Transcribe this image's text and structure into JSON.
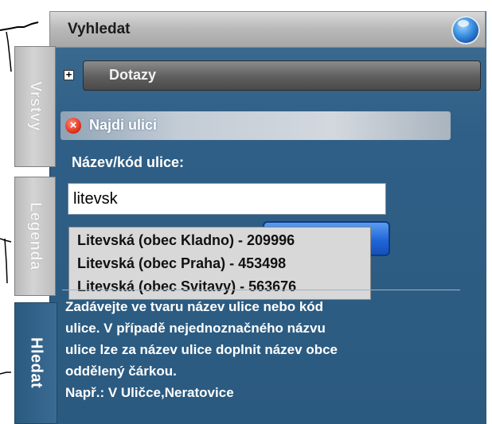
{
  "panel": {
    "title": "Vyhledat"
  },
  "tabs": [
    {
      "label": "Vrstvy"
    },
    {
      "label": "Legenda"
    },
    {
      "label": "Hledat"
    }
  ],
  "queries": {
    "expand_symbol": "+",
    "label": "Dotazy"
  },
  "find_street": {
    "close_symbol": "×",
    "title": "Najdi ulici",
    "field_label": "Název/kód ulice:",
    "input_value": "litevsk",
    "search_button_label": ""
  },
  "suggestions": [
    "Litevská (obec Kladno) - 209996",
    "Litevská (obec Praha) - 453498",
    "Litevská (obec Svitavy) - 563676"
  ],
  "help_text": {
    "lines": [
      "Zadávejte ve tvaru název ulice nebo kód",
      "ulice. V případě nejednoznačného názvu",
      "ulice lze za název ulice doplnit název obce",
      "oddělený čárkou.",
      "Např.: V Uličce,Neratovice"
    ]
  },
  "colors": {
    "panel": "#2f5f86",
    "accent_button": "#2066d8",
    "close": "#e2351f"
  },
  "icons": {
    "header_orb": "globe-orb-icon",
    "close": "close-icon",
    "expand": "plus-icon"
  }
}
